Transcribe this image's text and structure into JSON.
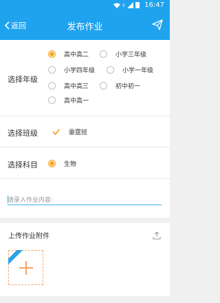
{
  "status_bar": {
    "time": "16:47",
    "network": "E"
  },
  "header": {
    "back_label": "返回",
    "title": "发布作业"
  },
  "grade_section": {
    "label": "选择年级",
    "options": [
      {
        "label": "高中高二",
        "selected": true
      },
      {
        "label": "小学三年级",
        "selected": false
      },
      {
        "label": "小学四年级",
        "selected": false
      },
      {
        "label": "小学一年级",
        "selected": false
      },
      {
        "label": "高中高三",
        "selected": false
      },
      {
        "label": "初中初一",
        "selected": false
      },
      {
        "label": "高中高一",
        "selected": false
      }
    ]
  },
  "class_section": {
    "label": "选择班级",
    "options": [
      {
        "label": "雷霆班",
        "checked": true
      }
    ]
  },
  "subject_section": {
    "label": "选择科目",
    "options": [
      {
        "label": "生物",
        "selected": true
      }
    ]
  },
  "homework_input": {
    "value": "",
    "placeholder": "请录入作业内容:"
  },
  "attachment": {
    "title": "上传作业附件"
  },
  "colors": {
    "primary": "#1fa3ef",
    "accent": "#f5a623",
    "add_tile": "#f5a66b",
    "ribbon": "#2aa3e6"
  }
}
